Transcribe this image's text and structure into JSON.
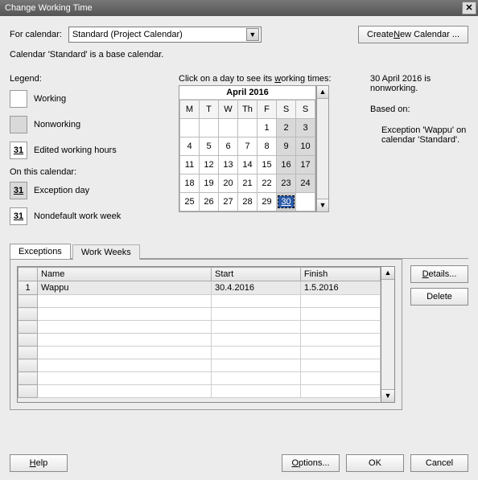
{
  "title": "Change Working Time",
  "forCalendarLabel": "For calendar:",
  "calendarSelected": "Standard (Project Calendar)",
  "createNewBtn_pre": "Create ",
  "createNewBtn_u": "N",
  "createNewBtn_post": "ew Calendar ...",
  "baseText": "Calendar 'Standard' is a base calendar.",
  "legend": {
    "title": "Legend:",
    "working": "Working",
    "nonworking": "Nonworking",
    "edited": "Edited working hours",
    "editedNum": "31",
    "onThis": "On this calendar:",
    "exception": "Exception day",
    "exceptionNum": "31",
    "nondefault": "Nondefault work week",
    "nondefaultNum": "31"
  },
  "calendar": {
    "hint_pre": "Click on a day to see its ",
    "hint_u": "w",
    "hint_post": "orking times:",
    "title": "April 2016",
    "headers": [
      "M",
      "T",
      "W",
      "Th",
      "F",
      "S",
      "S"
    ],
    "weeks": [
      [
        {
          "d": ""
        },
        {
          "d": ""
        },
        {
          "d": ""
        },
        {
          "d": ""
        },
        {
          "d": "1"
        },
        {
          "d": "2",
          "nw": true
        },
        {
          "d": "3",
          "nw": true
        }
      ],
      [
        {
          "d": "4"
        },
        {
          "d": "5"
        },
        {
          "d": "6"
        },
        {
          "d": "7"
        },
        {
          "d": "8"
        },
        {
          "d": "9",
          "nw": true
        },
        {
          "d": "10",
          "nw": true
        }
      ],
      [
        {
          "d": "11"
        },
        {
          "d": "12"
        },
        {
          "d": "13"
        },
        {
          "d": "14"
        },
        {
          "d": "15"
        },
        {
          "d": "16",
          "nw": true
        },
        {
          "d": "17",
          "nw": true
        }
      ],
      [
        {
          "d": "18"
        },
        {
          "d": "19"
        },
        {
          "d": "20"
        },
        {
          "d": "21"
        },
        {
          "d": "22"
        },
        {
          "d": "23",
          "nw": true
        },
        {
          "d": "24",
          "nw": true
        }
      ],
      [
        {
          "d": "25"
        },
        {
          "d": "26"
        },
        {
          "d": "27"
        },
        {
          "d": "28"
        },
        {
          "d": "29"
        },
        {
          "d": "30",
          "nw": true,
          "sel": true
        },
        {
          "d": ""
        }
      ]
    ]
  },
  "info": {
    "line1": "30 April 2016 is nonworking.",
    "basedOn": "Based on:",
    "detail1": "Exception 'Wappu' on",
    "detail2": "calendar 'Standard'."
  },
  "tabs": {
    "exceptions": "Exceptions",
    "workweeks": "Work Weeks"
  },
  "gridHeaders": {
    "name": "Name",
    "start": "Start",
    "finish": "Finish"
  },
  "exceptionsRows": [
    {
      "num": "1",
      "name": "Wappu",
      "start": "30.4.2016",
      "finish": "1.5.2016"
    }
  ],
  "buttons": {
    "details_u": "D",
    "details_post": "etails...",
    "delete": "Delete",
    "help_u": "H",
    "help_post": "elp",
    "options_u": "O",
    "options_post": "ptions...",
    "ok": "OK",
    "cancel": "Cancel"
  }
}
